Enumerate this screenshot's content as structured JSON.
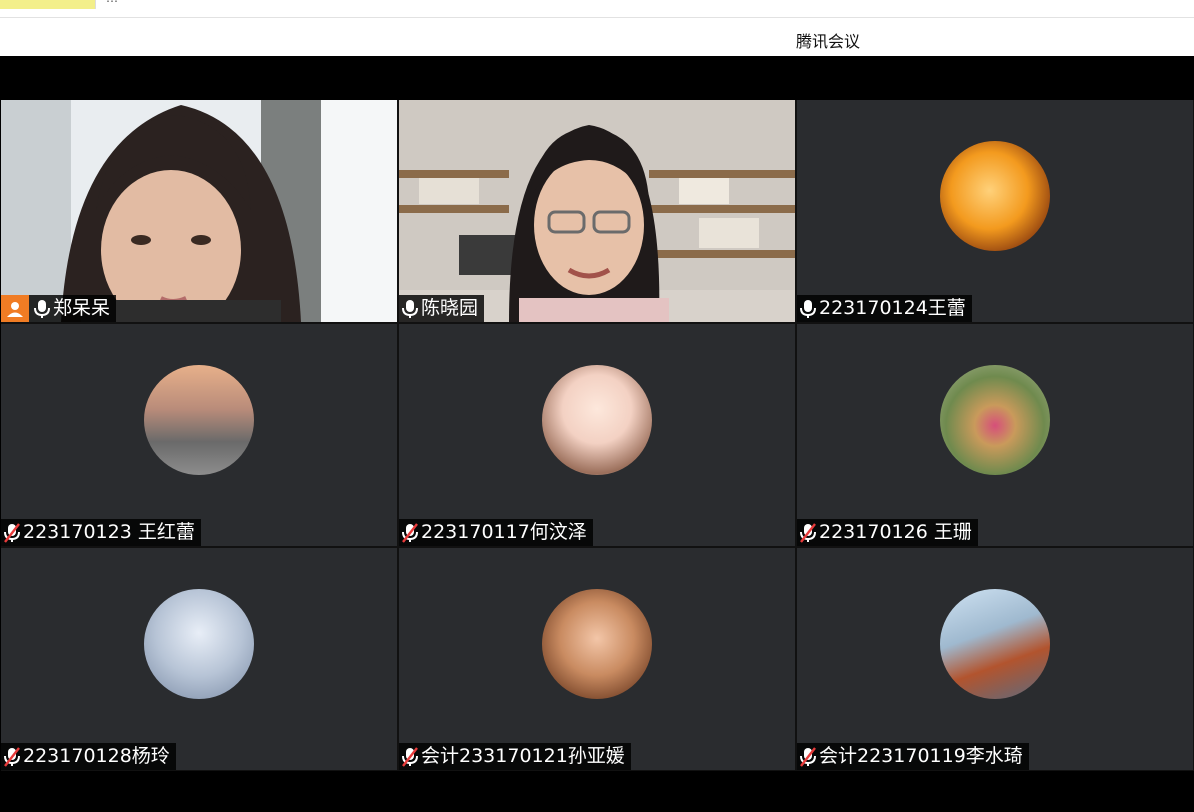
{
  "top": {
    "cut_text": "…"
  },
  "window": {
    "title": "腾讯会议"
  },
  "tiles": [
    {
      "name": "郑呆呆",
      "mic": "on",
      "host": true
    },
    {
      "name": "陈晓园",
      "mic": "on",
      "active": true
    },
    {
      "name": "223170124王蕾",
      "mic": "on"
    },
    {
      "name": "223170123 王红蕾",
      "mic": "muted"
    },
    {
      "name": "223170117何汶泽",
      "mic": "muted"
    },
    {
      "name": "223170126 王珊",
      "mic": "muted"
    },
    {
      "name": "223170128杨玲",
      "mic": "muted"
    },
    {
      "name": "会计233170121孙亚媛",
      "mic": "muted"
    },
    {
      "name": "会计223170119李水琦",
      "mic": "muted"
    }
  ],
  "colors": {
    "tile_bg": "#2a2c2f",
    "active_border": "#2fbf5e",
    "host_badge": "#f07c24",
    "mute_red": "#e83b3b"
  }
}
